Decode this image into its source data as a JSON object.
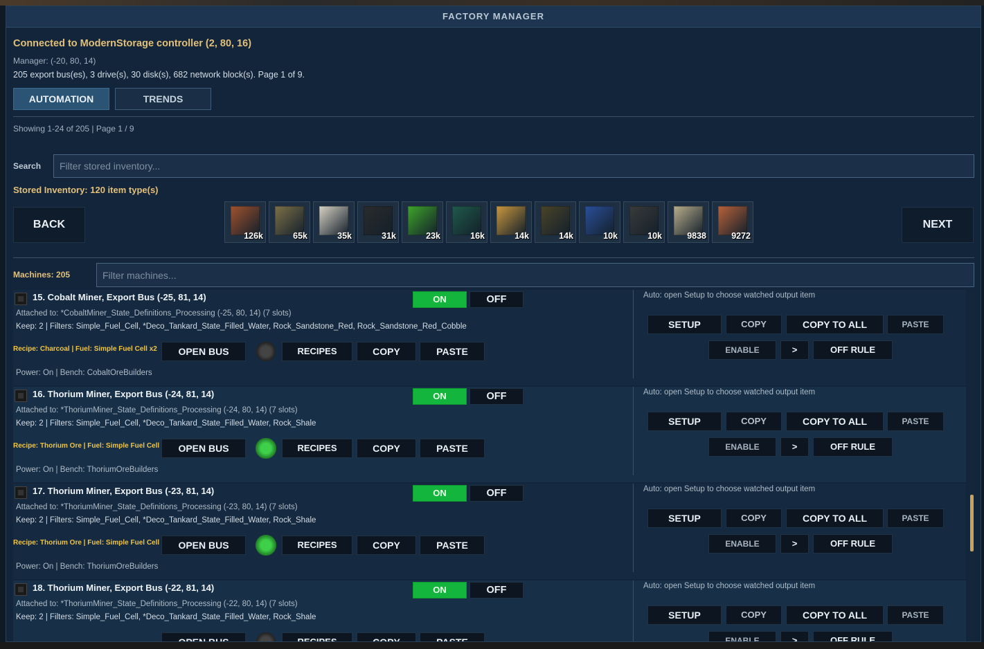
{
  "window": {
    "title": "FACTORY MANAGER"
  },
  "header": {
    "connected": "Connected to ModernStorage controller (2, 80, 16)",
    "manager": "Manager: (-20, 80, 14)",
    "stats": "205 export bus(es), 3 drive(s), 30 disk(s), 682 network block(s). Page 1 of 9."
  },
  "tabs": [
    {
      "label": "AUTOMATION",
      "active": true
    },
    {
      "label": "TRENDS",
      "active": false
    }
  ],
  "showing": "Showing 1-24 of 205 | Page 1 / 9",
  "search": {
    "label": "Search",
    "placeholder": "Filter stored inventory..."
  },
  "stored_label": "Stored Inventory: 120 item type(s)",
  "nav": {
    "back": "BACK",
    "next": "NEXT"
  },
  "inventory": [
    {
      "count": "126k",
      "icon": "red-sandstone-block",
      "color": "#a0522d"
    },
    {
      "count": "65k",
      "icon": "mossy-stone-block",
      "color": "#7d7048"
    },
    {
      "count": "35k",
      "icon": "quartz-crystal",
      "color": "#d8d2c4"
    },
    {
      "count": "31k",
      "icon": "coal-ore",
      "color": "#2b2b2b"
    },
    {
      "count": "23k",
      "icon": "green-pile",
      "color": "#3fa52a"
    },
    {
      "count": "16k",
      "icon": "green-stone-block",
      "color": "#1f5a4a"
    },
    {
      "count": "14k",
      "icon": "wood-block",
      "color": "#c9973e"
    },
    {
      "count": "14k",
      "icon": "dark-ore-block",
      "color": "#4a4428"
    },
    {
      "count": "10k",
      "icon": "blue-bar",
      "color": "#2a4f9a"
    },
    {
      "count": "10k",
      "icon": "iron-chunk",
      "color": "#3a3a3a"
    },
    {
      "count": "9838",
      "icon": "sand-pile",
      "color": "#b9ae8c"
    },
    {
      "count": "9272",
      "icon": "brick-block",
      "color": "#b8623a"
    }
  ],
  "machines": {
    "label": "Machines: 205",
    "filter_placeholder": "Filter machines...",
    "rows": [
      {
        "title": "15. Cobalt Miner, Export Bus (-25, 81, 14)",
        "attached": "Attached to: *CobaltMiner_State_Definitions_Processing (-25, 80, 14) (7 slots)",
        "keep": "Keep: 2 | Filters: Simple_Fuel_Cell, *Deco_Tankard_State_Filled_Water, Rock_Sandstone_Red, Rock_Sandstone_Red_Cobble",
        "recipe": "Recipe: Charcoal | Fuel: Simple Fuel Cell x2",
        "power": "Power: On | Bench: CobaltOreBuilders",
        "auto": "Auto: open Setup to choose watched output item",
        "recipe_icon": "charcoal-icon"
      },
      {
        "title": "16. Thorium Miner, Export Bus (-24, 81, 14)",
        "attached": "Attached to: *ThoriumMiner_State_Definitions_Processing (-24, 80, 14) (7 slots)",
        "keep": "Keep: 2 | Filters: Simple_Fuel_Cell, *Deco_Tankard_State_Filled_Water, Rock_Shale",
        "recipe": "Recipe: Thorium Ore | Fuel: Simple Fuel Cell ...",
        "power": "Power: On | Bench: ThoriumOreBuilders",
        "auto": "Auto: open Setup to choose watched output item",
        "recipe_icon": "thorium-ore-icon"
      },
      {
        "title": "17. Thorium Miner, Export Bus (-23, 81, 14)",
        "attached": "Attached to: *ThoriumMiner_State_Definitions_Processing (-23, 80, 14) (7 slots)",
        "keep": "Keep: 2 | Filters: Simple_Fuel_Cell, *Deco_Tankard_State_Filled_Water, Rock_Shale",
        "recipe": "Recipe: Thorium Ore | Fuel: Simple Fuel Cell ...",
        "power": "Power: On | Bench: ThoriumOreBuilders",
        "auto": "Auto: open Setup to choose watched output item",
        "recipe_icon": "thorium-ore-icon"
      },
      {
        "title": "18. Thorium Miner, Export Bus (-22, 81, 14)",
        "attached": "Attached to: *ThoriumMiner_State_Definitions_Processing (-22, 80, 14) (7 slots)",
        "keep": "Keep: 2 | Filters: Simple_Fuel_Cell, *Deco_Tankard_State_Filled_Water, Rock_Shale",
        "recipe": "",
        "power": "",
        "auto": "Auto: open Setup to choose watched output item",
        "recipe_icon": "charcoal-icon"
      }
    ]
  },
  "row_buttons": {
    "on": "ON",
    "off": "OFF",
    "open_bus": "OPEN BUS",
    "recipes": "RECIPES",
    "copy": "COPY",
    "paste": "PASTE",
    "setup": "SETUP",
    "copy_to_all": "COPY TO ALL",
    "enable": "ENABLE",
    "arrow": ">",
    "off_rule": "OFF RULE"
  }
}
